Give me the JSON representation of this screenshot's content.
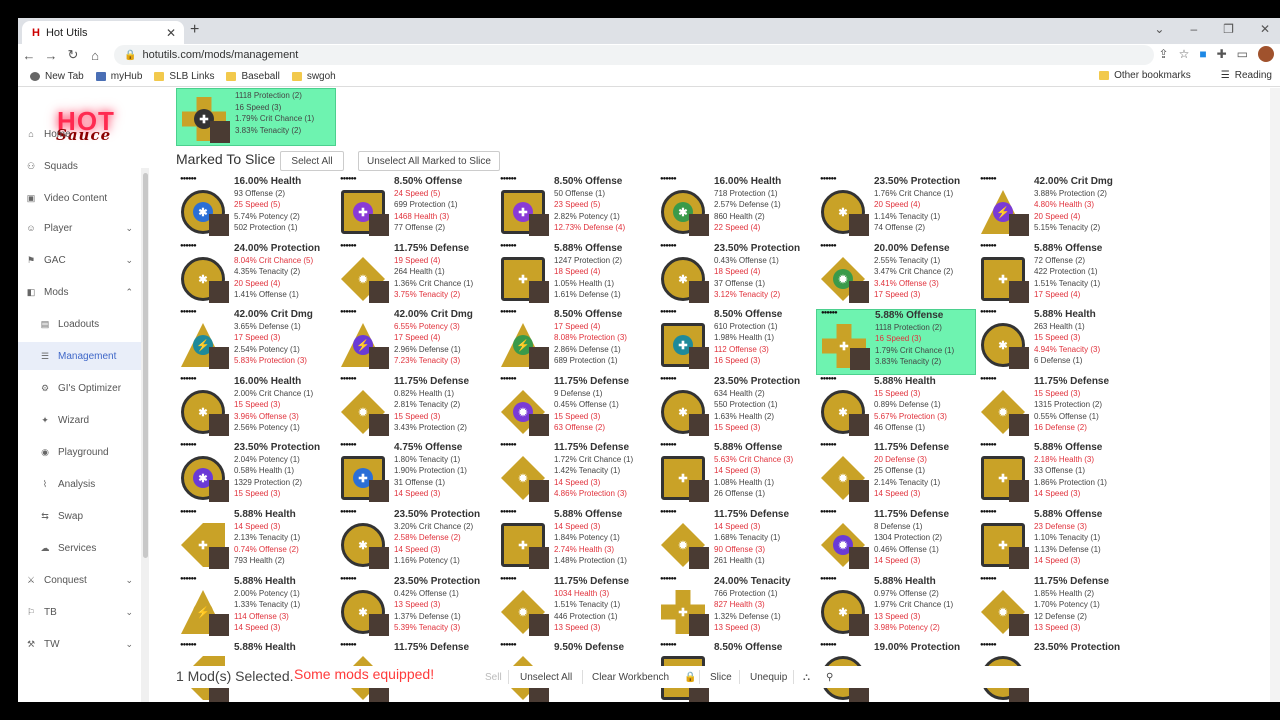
{
  "browser": {
    "tab_title": "Hot Utils",
    "tab_favicon": "H",
    "url": "hotutils.com/mods/management",
    "bookmarks": [
      "New Tab",
      "myHub",
      "SLB Links",
      "Baseball",
      "swgoh"
    ],
    "other_bookmarks": "Other bookmarks",
    "reading_list": "Reading"
  },
  "logo": {
    "main": "HOT",
    "sub": "Sauce"
  },
  "sidebar": {
    "items": [
      {
        "label": "Home",
        "icon": "home-icon"
      },
      {
        "label": "Squads",
        "icon": "squads-icon"
      },
      {
        "label": "Video Content",
        "icon": "video-icon"
      },
      {
        "label": "Player",
        "icon": "player-icon",
        "chevron": "down"
      },
      {
        "label": "GAC",
        "icon": "gac-icon",
        "chevron": "down"
      },
      {
        "label": "Mods",
        "icon": "mods-icon",
        "chevron": "up"
      },
      {
        "label": "Loadouts",
        "icon": "loadouts-icon",
        "sub": true
      },
      {
        "label": "Management",
        "icon": "management-icon",
        "sub": true,
        "active": true
      },
      {
        "label": "GI's Optimizer",
        "icon": "optimizer-icon",
        "sub": true
      },
      {
        "label": "Wizard",
        "icon": "wizard-icon",
        "sub": true
      },
      {
        "label": "Playground",
        "icon": "playground-icon",
        "sub": true
      },
      {
        "label": "Analysis",
        "icon": "analysis-icon",
        "sub": true
      },
      {
        "label": "Swap",
        "icon": "swap-icon",
        "sub": true
      },
      {
        "label": "Services",
        "icon": "services-icon",
        "sub": true
      },
      {
        "label": "Conquest",
        "icon": "conquest-icon",
        "chevron": "down"
      },
      {
        "label": "TB",
        "icon": "tb-icon",
        "chevron": "down"
      },
      {
        "label": "TW",
        "icon": "tw-icon",
        "chevron": "down"
      }
    ]
  },
  "top_mod": {
    "lines": [
      "1118 Protection (2)",
      "16 Speed (3)",
      "1.79% Crit Chance (1)",
      "3.83% Tenacity (2)"
    ],
    "shape": "cross",
    "color": "#c9a227"
  },
  "section": {
    "title": "Marked To Slice",
    "select_all": "Select All",
    "unselect_all": "Unselect All Marked to Slice"
  },
  "mods": [
    {
      "primary": "16.00% Health",
      "shape": "circle",
      "gem": "#2b6fd6",
      "lines": [
        [
          "93 Offense (2)",
          0
        ],
        [
          "25 Speed (5)",
          1
        ],
        [
          "5.74% Potency (2)",
          0
        ],
        [
          "502 Protection (1)",
          0
        ]
      ]
    },
    {
      "primary": "8.50% Offense",
      "shape": "square",
      "gem": "#8a3ad6",
      "lines": [
        [
          "24 Speed (5)",
          1
        ],
        [
          "699 Protection (1)",
          0
        ],
        [
          "1468 Health (3)",
          1
        ],
        [
          "77 Offense (2)",
          0
        ]
      ]
    },
    {
      "primary": "8.50% Offense",
      "shape": "square",
      "gem": "#8a3ad6",
      "lines": [
        [
          "50 Offense (1)",
          0
        ],
        [
          "23 Speed (5)",
          1
        ],
        [
          "2.82% Potency (1)",
          0
        ],
        [
          "12.73% Defense (4)",
          1
        ]
      ]
    },
    {
      "primary": "16.00% Health",
      "shape": "circle",
      "gem": "#3a9a4a",
      "lines": [
        [
          "718 Protection (1)",
          0
        ],
        [
          "2.57% Defense (1)",
          0
        ],
        [
          "860 Health (2)",
          0
        ],
        [
          "22 Speed (4)",
          1
        ]
      ]
    },
    {
      "primary": "23.50% Protection",
      "shape": "circle",
      "gem": "#c9a227",
      "lines": [
        [
          "1.76% Crit Chance (1)",
          0
        ],
        [
          "20 Speed (4)",
          1
        ],
        [
          "1.14% Tenacity (1)",
          0
        ],
        [
          "74 Offense (2)",
          0
        ]
      ]
    },
    {
      "primary": "42.00% Crit Dmg",
      "shape": "triangle",
      "gem": "#7a3ad6",
      "lines": [
        [
          "3.88% Protection (2)",
          0
        ],
        [
          "4.80% Health (3)",
          1
        ],
        [
          "20 Speed (4)",
          1
        ],
        [
          "5.15% Tenacity (2)",
          0
        ]
      ]
    },
    {
      "primary": "24.00% Protection",
      "shape": "circle",
      "gem": "#c9a227",
      "lines": [
        [
          "8.04% Crit Chance (5)",
          1
        ],
        [
          "4.35% Tenacity (2)",
          0
        ],
        [
          "20 Speed (4)",
          1
        ],
        [
          "1.41% Offense (1)",
          0
        ]
      ]
    },
    {
      "primary": "11.75% Defense",
      "shape": "diamond",
      "gem": "#c9a227",
      "lines": [
        [
          "19 Speed (4)",
          1
        ],
        [
          "264 Health (1)",
          0
        ],
        [
          "1.36% Crit Chance (1)",
          0
        ],
        [
          "3.75% Tenacity (2)",
          1
        ]
      ]
    },
    {
      "primary": "5.88% Offense",
      "shape": "square",
      "gem": "#c9a227",
      "lines": [
        [
          "1247 Protection (2)",
          0
        ],
        [
          "18 Speed (4)",
          1
        ],
        [
          "1.05% Health (1)",
          0
        ],
        [
          "1.61% Defense (1)",
          0
        ]
      ]
    },
    {
      "primary": "23.50% Protection",
      "shape": "circle",
      "gem": "#c9a227",
      "lines": [
        [
          "0.43% Offense (1)",
          0
        ],
        [
          "18 Speed (4)",
          1
        ],
        [
          "37 Offense (1)",
          0
        ],
        [
          "3.12% Tenacity (2)",
          1
        ]
      ]
    },
    {
      "primary": "20.00% Defense",
      "shape": "diamond",
      "gem": "#3a9a4a",
      "lines": [
        [
          "2.55% Tenacity (1)",
          0
        ],
        [
          "3.47% Crit Chance (2)",
          0
        ],
        [
          "3.41% Offense (3)",
          1
        ],
        [
          "17 Speed (3)",
          1
        ]
      ]
    },
    {
      "primary": "5.88% Offense",
      "shape": "square",
      "gem": "#c9a227",
      "lines": [
        [
          "72 Offense (2)",
          0
        ],
        [
          "422 Protection (1)",
          0
        ],
        [
          "1.51% Tenacity (1)",
          0
        ],
        [
          "17 Speed (4)",
          1
        ]
      ]
    },
    {
      "primary": "42.00% Crit Dmg",
      "shape": "triangle",
      "gem": "#1f8a9a",
      "lines": [
        [
          "3.65% Defense (1)",
          0
        ],
        [
          "17 Speed (3)",
          1
        ],
        [
          "2.54% Potency (1)",
          0
        ],
        [
          "5.83% Protection (3)",
          1
        ]
      ]
    },
    {
      "primary": "42.00% Crit Dmg",
      "shape": "triangle",
      "gem": "#6a3ad6",
      "lines": [
        [
          "6.55% Potency (3)",
          1
        ],
        [
          "17 Speed (4)",
          1
        ],
        [
          "2.96% Defense (1)",
          0
        ],
        [
          "7.23% Tenacity (3)",
          1
        ]
      ]
    },
    {
      "primary": "8.50% Offense",
      "shape": "triangle",
      "gem": "#3a9a4a",
      "lines": [
        [
          "17 Speed (4)",
          1
        ],
        [
          "8.08% Protection (3)",
          1
        ],
        [
          "2.86% Defense (1)",
          0
        ],
        [
          "689 Protection (1)",
          0
        ]
      ]
    },
    {
      "primary": "8.50% Offense",
      "shape": "square",
      "gem": "#1f8a9a",
      "lines": [
        [
          "610 Protection (1)",
          0
        ],
        [
          "1.98% Health (1)",
          0
        ],
        [
          "112 Offense (3)",
          1
        ],
        [
          "16 Speed (3)",
          1
        ]
      ]
    },
    {
      "primary": "5.88% Offense",
      "shape": "cross",
      "gem": "#c9a227",
      "selected": true,
      "lines": [
        [
          "1118 Protection (2)",
          0
        ],
        [
          "16 Speed (3)",
          1
        ],
        [
          "1.79% Crit Chance (1)",
          0
        ],
        [
          "3.83% Tenacity (2)",
          0
        ]
      ]
    },
    {
      "primary": "5.88% Health",
      "shape": "circle",
      "gem": "#c9a227",
      "lines": [
        [
          "263 Health (1)",
          0
        ],
        [
          "15 Speed (3)",
          1
        ],
        [
          "4.94% Tenacity (3)",
          1
        ],
        [
          "6 Defense (1)",
          0
        ]
      ]
    },
    {
      "primary": "16.00% Health",
      "shape": "circle",
      "gem": "#c9a227",
      "lines": [
        [
          "2.00% Crit Chance (1)",
          0
        ],
        [
          "15 Speed (3)",
          1
        ],
        [
          "3.96% Offense (3)",
          1
        ],
        [
          "2.56% Potency (1)",
          0
        ]
      ]
    },
    {
      "primary": "11.75% Defense",
      "shape": "diamond",
      "gem": "#c9a227",
      "lines": [
        [
          "0.82% Health (1)",
          0
        ],
        [
          "2.81% Tenacity (2)",
          0
        ],
        [
          "15 Speed (3)",
          1
        ],
        [
          "3.43% Protection (2)",
          0
        ]
      ]
    },
    {
      "primary": "11.75% Defense",
      "shape": "diamond",
      "gem": "#7a3ad6",
      "lines": [
        [
          "9 Defense (1)",
          0
        ],
        [
          "0.45% Offense (1)",
          0
        ],
        [
          "15 Speed (3)",
          1
        ],
        [
          "63 Offense (2)",
          1
        ]
      ]
    },
    {
      "primary": "23.50% Protection",
      "shape": "circle",
      "gem": "#c9a227",
      "lines": [
        [
          "634 Health (2)",
          0
        ],
        [
          "550 Protection (1)",
          0
        ],
        [
          "1.63% Health (2)",
          0
        ],
        [
          "15 Speed (3)",
          1
        ]
      ]
    },
    {
      "primary": "5.88% Health",
      "shape": "circle",
      "gem": "#c9a227",
      "lines": [
        [
          "15 Speed (3)",
          1
        ],
        [
          "0.89% Defense (1)",
          0
        ],
        [
          "5.67% Protection (3)",
          1
        ],
        [
          "46 Offense (1)",
          0
        ]
      ]
    },
    {
      "primary": "11.75% Defense",
      "shape": "diamond",
      "gem": "#c9a227",
      "lines": [
        [
          "15 Speed (3)",
          1
        ],
        [
          "1315 Protection (2)",
          0
        ],
        [
          "0.55% Offense (1)",
          0
        ],
        [
          "16 Defense (2)",
          1
        ]
      ]
    },
    {
      "primary": "23.50% Protection",
      "shape": "circle",
      "gem": "#6a3ad6",
      "lines": [
        [
          "2.04% Potency (1)",
          0
        ],
        [
          "0.58% Health (1)",
          0
        ],
        [
          "1329 Protection (2)",
          0
        ],
        [
          "15 Speed (3)",
          1
        ]
      ]
    },
    {
      "primary": "4.75% Offense",
      "shape": "square",
      "gem": "#2b6fd6",
      "lines": [
        [
          "1.80% Tenacity (1)",
          0
        ],
        [
          "1.90% Protection (1)",
          0
        ],
        [
          "31 Offense (1)",
          0
        ],
        [
          "14 Speed (3)",
          1
        ]
      ]
    },
    {
      "primary": "11.75% Defense",
      "shape": "diamond",
      "gem": "#c9a227",
      "lines": [
        [
          "1.72% Crit Chance (1)",
          0
        ],
        [
          "1.42% Tenacity (1)",
          0
        ],
        [
          "14 Speed (3)",
          1
        ],
        [
          "4.86% Protection (3)",
          1
        ]
      ]
    },
    {
      "primary": "5.88% Offense",
      "shape": "square",
      "gem": "#c9a227",
      "lines": [
        [
          "5.63% Crit Chance (3)",
          1
        ],
        [
          "14 Speed (3)",
          1
        ],
        [
          "1.08% Health (1)",
          0
        ],
        [
          "26 Offense (1)",
          0
        ]
      ]
    },
    {
      "primary": "11.75% Defense",
      "shape": "diamond",
      "gem": "#c9a227",
      "lines": [
        [
          "20 Defense (3)",
          1
        ],
        [
          "25 Offense (1)",
          0
        ],
        [
          "2.14% Tenacity (1)",
          0
        ],
        [
          "14 Speed (3)",
          1
        ]
      ]
    },
    {
      "primary": "5.88% Offense",
      "shape": "square",
      "gem": "#c9a227",
      "lines": [
        [
          "2.18% Health (3)",
          1
        ],
        [
          "33 Offense (1)",
          0
        ],
        [
          "1.86% Protection (1)",
          0
        ],
        [
          "14 Speed (3)",
          1
        ]
      ]
    },
    {
      "primary": "5.88% Health",
      "shape": "arrow",
      "gem": "#c9a227",
      "lines": [
        [
          "14 Speed (3)",
          1
        ],
        [
          "2.13% Tenacity (1)",
          0
        ],
        [
          "0.74% Offense (2)",
          1
        ],
        [
          "793 Health (2)",
          0
        ]
      ]
    },
    {
      "primary": "23.50% Protection",
      "shape": "circle",
      "gem": "#c9a227",
      "lines": [
        [
          "3.20% Crit Chance (2)",
          0
        ],
        [
          "2.58% Defense (2)",
          1
        ],
        [
          "14 Speed (3)",
          1
        ],
        [
          "1.16% Potency (1)",
          0
        ]
      ]
    },
    {
      "primary": "5.88% Offense",
      "shape": "square",
      "gem": "#c9a227",
      "lines": [
        [
          "14 Speed (3)",
          1
        ],
        [
          "1.84% Potency (1)",
          0
        ],
        [
          "2.74% Health (3)",
          1
        ],
        [
          "1.48% Protection (1)",
          0
        ]
      ]
    },
    {
      "primary": "11.75% Defense",
      "shape": "diamond",
      "gem": "#c9a227",
      "lines": [
        [
          "14 Speed (3)",
          1
        ],
        [
          "1.68% Tenacity (1)",
          0
        ],
        [
          "90 Offense (3)",
          1
        ],
        [
          "261 Health (1)",
          0
        ]
      ]
    },
    {
      "primary": "11.75% Defense",
      "shape": "diamond",
      "gem": "#6a3ad6",
      "lines": [
        [
          "8 Defense (1)",
          0
        ],
        [
          "1304 Protection (2)",
          0
        ],
        [
          "0.46% Offense (1)",
          0
        ],
        [
          "14 Speed (3)",
          1
        ]
      ]
    },
    {
      "primary": "5.88% Offense",
      "shape": "square",
      "gem": "#c9a227",
      "lines": [
        [
          "23 Defense (3)",
          1
        ],
        [
          "1.10% Tenacity (1)",
          0
        ],
        [
          "1.13% Defense (1)",
          0
        ],
        [
          "14 Speed (3)",
          1
        ]
      ]
    },
    {
      "primary": "5.88% Health",
      "shape": "triangle",
      "gem": "#c9a227",
      "lines": [
        [
          "2.00% Potency (1)",
          0
        ],
        [
          "1.33% Tenacity (1)",
          0
        ],
        [
          "114 Offense (3)",
          1
        ],
        [
          "14 Speed (3)",
          1
        ]
      ]
    },
    {
      "primary": "23.50% Protection",
      "shape": "circle",
      "gem": "#c9a227",
      "lines": [
        [
          "0.42% Offense (1)",
          0
        ],
        [
          "13 Speed (3)",
          1
        ],
        [
          "1.37% Defense (1)",
          0
        ],
        [
          "5.39% Tenacity (3)",
          1
        ]
      ]
    },
    {
      "primary": "11.75% Defense",
      "shape": "diamond",
      "gem": "#c9a227",
      "lines": [
        [
          "1034 Health (3)",
          1
        ],
        [
          "1.51% Tenacity (1)",
          0
        ],
        [
          "446 Protection (1)",
          0
        ],
        [
          "13 Speed (3)",
          1
        ]
      ]
    },
    {
      "primary": "24.00% Tenacity",
      "shape": "cross",
      "gem": "#c9a227",
      "lines": [
        [
          "766 Protection (1)",
          0
        ],
        [
          "827 Health (3)",
          1
        ],
        [
          "1.32% Defense (1)",
          0
        ],
        [
          "13 Speed (3)",
          1
        ]
      ]
    },
    {
      "primary": "5.88% Health",
      "shape": "circle",
      "gem": "#c9a227",
      "lines": [
        [
          "0.97% Offense (2)",
          0
        ],
        [
          "1.97% Crit Chance (1)",
          0
        ],
        [
          "13 Speed (3)",
          1
        ],
        [
          "3.98% Potency (2)",
          1
        ]
      ]
    },
    {
      "primary": "11.75% Defense",
      "shape": "diamond",
      "gem": "#c9a227",
      "lines": [
        [
          "1.85% Health (2)",
          0
        ],
        [
          "1.70% Potency (1)",
          0
        ],
        [
          "12 Defense (2)",
          0
        ],
        [
          "13 Speed (3)",
          1
        ]
      ]
    },
    {
      "primary": "5.88% Health",
      "shape": "arrow",
      "gem": "#c9a227",
      "lines": []
    },
    {
      "primary": "11.75% Defense",
      "shape": "diamond",
      "gem": "#c9a227",
      "lines": []
    },
    {
      "primary": "9.50% Defense",
      "shape": "diamond",
      "gem": "#6a3ad6",
      "lines": []
    },
    {
      "primary": "8.50% Offense",
      "shape": "square",
      "gem": "#c9a227",
      "lines": []
    },
    {
      "primary": "19.00% Protection",
      "shape": "circle",
      "gem": "#c9a227",
      "lines": []
    },
    {
      "primary": "23.50% Protection",
      "shape": "circle",
      "gem": "#c9a227",
      "lines": []
    }
  ],
  "bottom": {
    "selected": "1 Mod(s) Selected.",
    "warning": "Some mods equipped!",
    "sell": "Sell",
    "unselect_all": "Unselect All",
    "clear_workbench": "Clear Workbench",
    "slice": "Slice",
    "unequip": "Unequip"
  },
  "colors": {
    "accent": "#3f67c8",
    "selection": "#6ef3b0",
    "highlight": "#e0323c",
    "warning": "#ff3b3b"
  }
}
